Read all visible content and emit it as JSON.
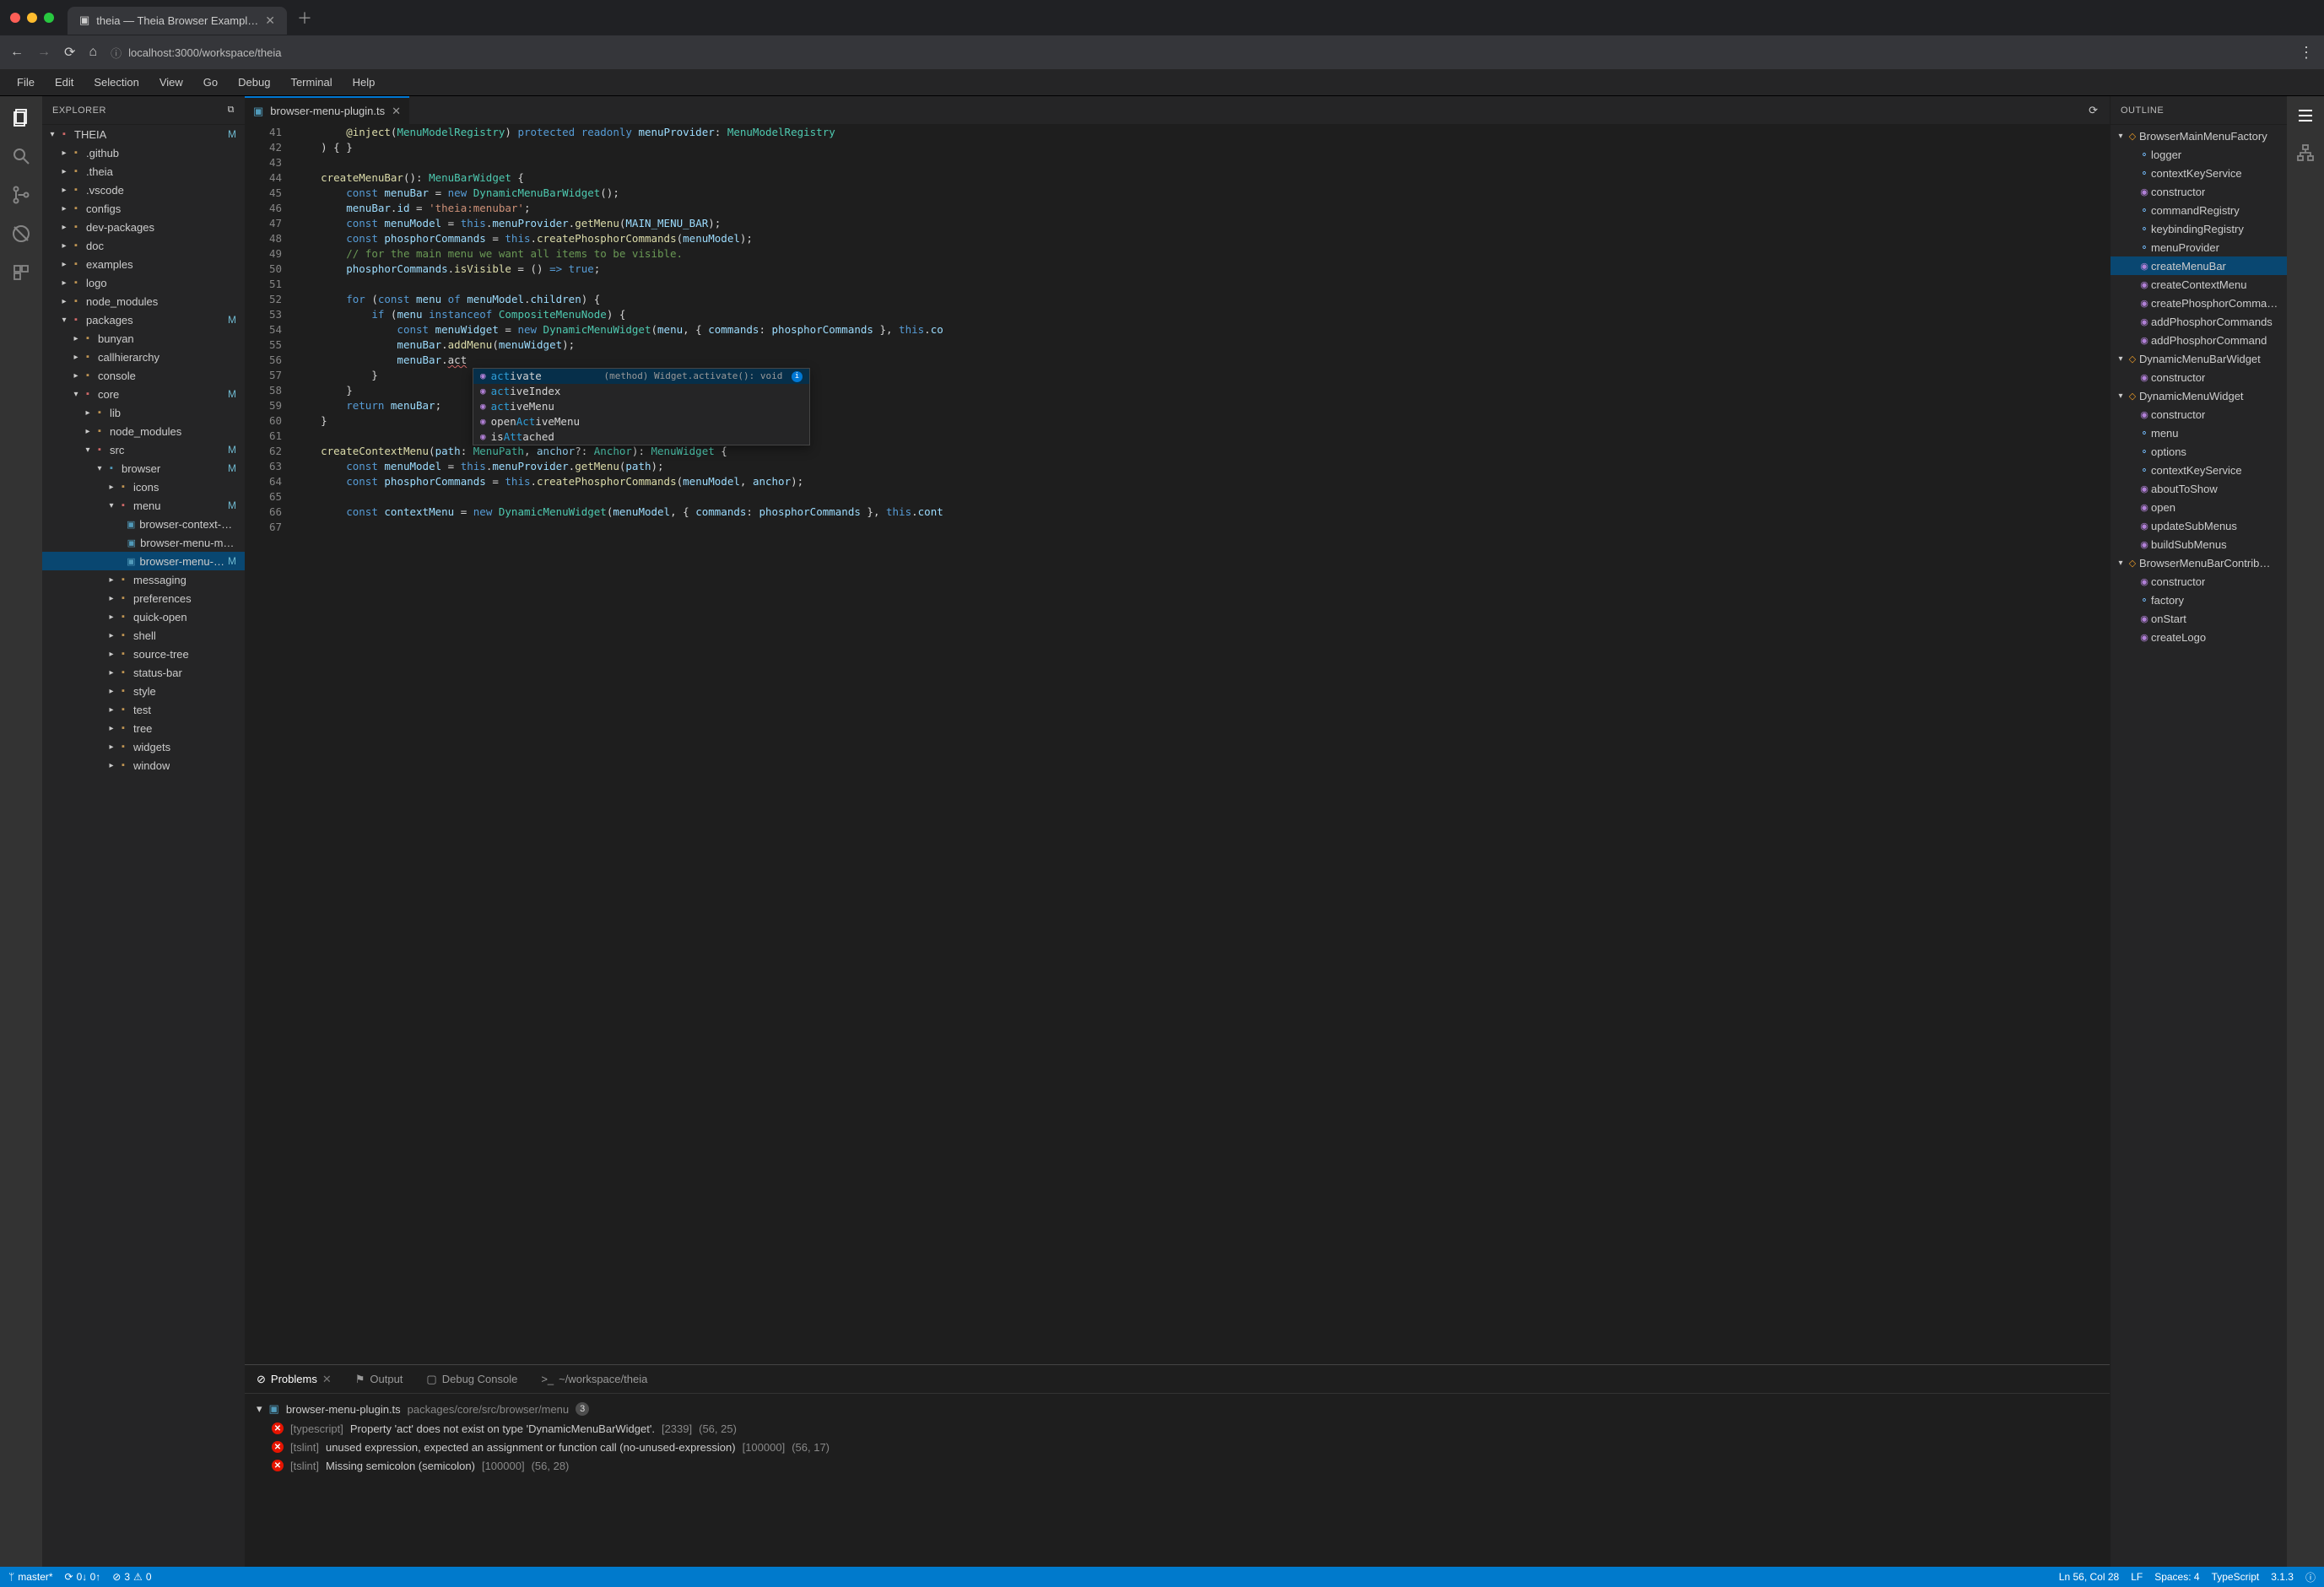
{
  "browser": {
    "tab_title": "theia — Theia Browser Exampl…",
    "url": "localhost:3000/workspace/theia"
  },
  "menubar": [
    "File",
    "Edit",
    "Selection",
    "View",
    "Go",
    "Debug",
    "Terminal",
    "Help"
  ],
  "explorer": {
    "title": "EXPLORER",
    "root": "THEIA",
    "root_badge": "M",
    "tree": [
      {
        "label": ".github",
        "kind": "folder",
        "indent": 1
      },
      {
        "label": ".theia",
        "kind": "folder",
        "indent": 1
      },
      {
        "label": ".vscode",
        "kind": "folder",
        "indent": 1
      },
      {
        "label": "configs",
        "kind": "folder",
        "indent": 1
      },
      {
        "label": "dev-packages",
        "kind": "folder",
        "indent": 1
      },
      {
        "label": "doc",
        "kind": "folder",
        "indent": 1
      },
      {
        "label": "examples",
        "kind": "folder",
        "indent": 1
      },
      {
        "label": "logo",
        "kind": "folder",
        "indent": 1
      },
      {
        "label": "node_modules",
        "kind": "folder",
        "indent": 1
      },
      {
        "label": "packages",
        "kind": "folder-red",
        "indent": 1,
        "open": true,
        "badge": "M"
      },
      {
        "label": "bunyan",
        "kind": "folder",
        "indent": 2
      },
      {
        "label": "callhierarchy",
        "kind": "folder",
        "indent": 2
      },
      {
        "label": "console",
        "kind": "folder",
        "indent": 2
      },
      {
        "label": "core",
        "kind": "folder-red",
        "indent": 2,
        "open": true,
        "badge": "M"
      },
      {
        "label": "lib",
        "kind": "folder",
        "indent": 3
      },
      {
        "label": "node_modules",
        "kind": "folder",
        "indent": 3
      },
      {
        "label": "src",
        "kind": "folder-red",
        "indent": 3,
        "open": true,
        "badge": "M"
      },
      {
        "label": "browser",
        "kind": "folder-blue",
        "indent": 4,
        "open": true,
        "badge": "M"
      },
      {
        "label": "icons",
        "kind": "folder",
        "indent": 5
      },
      {
        "label": "menu",
        "kind": "folder-red",
        "indent": 5,
        "open": true,
        "badge": "M"
      },
      {
        "label": "browser-context-menu-r…",
        "kind": "ts",
        "indent": 6
      },
      {
        "label": "browser-menu-module.ts",
        "kind": "ts",
        "indent": 6
      },
      {
        "label": "browser-menu-plugin.ts",
        "kind": "ts",
        "indent": 6,
        "badge": "M",
        "selected": true
      },
      {
        "label": "messaging",
        "kind": "folder",
        "indent": 5
      },
      {
        "label": "preferences",
        "kind": "folder",
        "indent": 5
      },
      {
        "label": "quick-open",
        "kind": "folder",
        "indent": 5
      },
      {
        "label": "shell",
        "kind": "folder",
        "indent": 5
      },
      {
        "label": "source-tree",
        "kind": "folder",
        "indent": 5
      },
      {
        "label": "status-bar",
        "kind": "folder",
        "indent": 5
      },
      {
        "label": "style",
        "kind": "folder",
        "indent": 5
      },
      {
        "label": "test",
        "kind": "folder",
        "indent": 5
      },
      {
        "label": "tree",
        "kind": "folder",
        "indent": 5
      },
      {
        "label": "widgets",
        "kind": "folder",
        "indent": 5
      },
      {
        "label": "window",
        "kind": "folder",
        "indent": 5
      }
    ]
  },
  "editor_tab": {
    "label": "browser-menu-plugin.ts"
  },
  "gutter_start": 41,
  "gutter_end": 67,
  "suggest": {
    "items": [
      {
        "pre": "act",
        "post": "ivate",
        "detail": "(method) Widget.activate(): void",
        "selected": true
      },
      {
        "pre": "act",
        "post": "iveIndex"
      },
      {
        "pre": "act",
        "post": "iveMenu"
      },
      {
        "prefix": "open",
        "pre": "Act",
        "post": "iveMenu"
      },
      {
        "prefix": "is",
        "pre": "Att",
        "post": "ached"
      }
    ]
  },
  "panels": {
    "tabs": {
      "problems": "Problems",
      "output": "Output",
      "debug": "Debug Console",
      "terminal": "~/workspace/theia"
    },
    "file": {
      "name": "browser-menu-plugin.ts",
      "path": "packages/core/src/browser/menu",
      "count": "3"
    },
    "problems": [
      {
        "source": "[typescript]",
        "msg": "Property 'act' does not exist on type 'DynamicMenuBarWidget'.",
        "code": "[2339]",
        "loc": "(56, 25)"
      },
      {
        "source": "[tslint]",
        "msg": "unused expression, expected an assignment or function call (no-unused-expression)",
        "code": "[100000]",
        "loc": "(56, 17)"
      },
      {
        "source": "[tslint]",
        "msg": "Missing semicolon (semicolon)",
        "code": "[100000]",
        "loc": "(56, 28)"
      }
    ]
  },
  "outline": {
    "title": "OUTLINE",
    "items": [
      {
        "label": "BrowserMainMenuFactory",
        "kind": "class",
        "indent": 0,
        "open": true
      },
      {
        "label": "logger",
        "kind": "field",
        "indent": 1
      },
      {
        "label": "contextKeyService",
        "kind": "field",
        "indent": 1
      },
      {
        "label": "constructor",
        "kind": "method",
        "indent": 1
      },
      {
        "label": "commandRegistry",
        "kind": "field",
        "indent": 1
      },
      {
        "label": "keybindingRegistry",
        "kind": "field",
        "indent": 1
      },
      {
        "label": "menuProvider",
        "kind": "field",
        "indent": 1
      },
      {
        "label": "createMenuBar",
        "kind": "method",
        "indent": 1,
        "selected": true
      },
      {
        "label": "createContextMenu",
        "kind": "method",
        "indent": 1
      },
      {
        "label": "createPhosphorComma…",
        "kind": "method",
        "indent": 1
      },
      {
        "label": "addPhosphorCommands",
        "kind": "method",
        "indent": 1
      },
      {
        "label": "addPhosphorCommand",
        "kind": "method",
        "indent": 1
      },
      {
        "label": "DynamicMenuBarWidget",
        "kind": "class",
        "indent": 0,
        "open": true
      },
      {
        "label": "constructor",
        "kind": "method",
        "indent": 1
      },
      {
        "label": "DynamicMenuWidget",
        "kind": "class",
        "indent": 0,
        "open": true
      },
      {
        "label": "constructor",
        "kind": "method",
        "indent": 1
      },
      {
        "label": "menu",
        "kind": "field",
        "indent": 1
      },
      {
        "label": "options",
        "kind": "field",
        "indent": 1
      },
      {
        "label": "contextKeyService",
        "kind": "field",
        "indent": 1
      },
      {
        "label": "aboutToShow",
        "kind": "method",
        "indent": 1
      },
      {
        "label": "open",
        "kind": "method",
        "indent": 1
      },
      {
        "label": "updateSubMenus",
        "kind": "method",
        "indent": 1
      },
      {
        "label": "buildSubMenus",
        "kind": "method",
        "indent": 1
      },
      {
        "label": "BrowserMenuBarContrib…",
        "kind": "class",
        "indent": 0,
        "open": true
      },
      {
        "label": "constructor",
        "kind": "method",
        "indent": 1
      },
      {
        "label": "factory",
        "kind": "field",
        "indent": 1
      },
      {
        "label": "onStart",
        "kind": "method",
        "indent": 1
      },
      {
        "label": "createLogo",
        "kind": "method",
        "indent": 1
      }
    ]
  },
  "status": {
    "branch": "master*",
    "sync": "0↓ 0↑",
    "errors": "3",
    "warnings": "0",
    "line_col": "Ln 56, Col 28",
    "eol": "LF",
    "indent": "Spaces: 4",
    "lang": "TypeScript",
    "version": "3.1.3",
    "bell": "ⓘ"
  }
}
